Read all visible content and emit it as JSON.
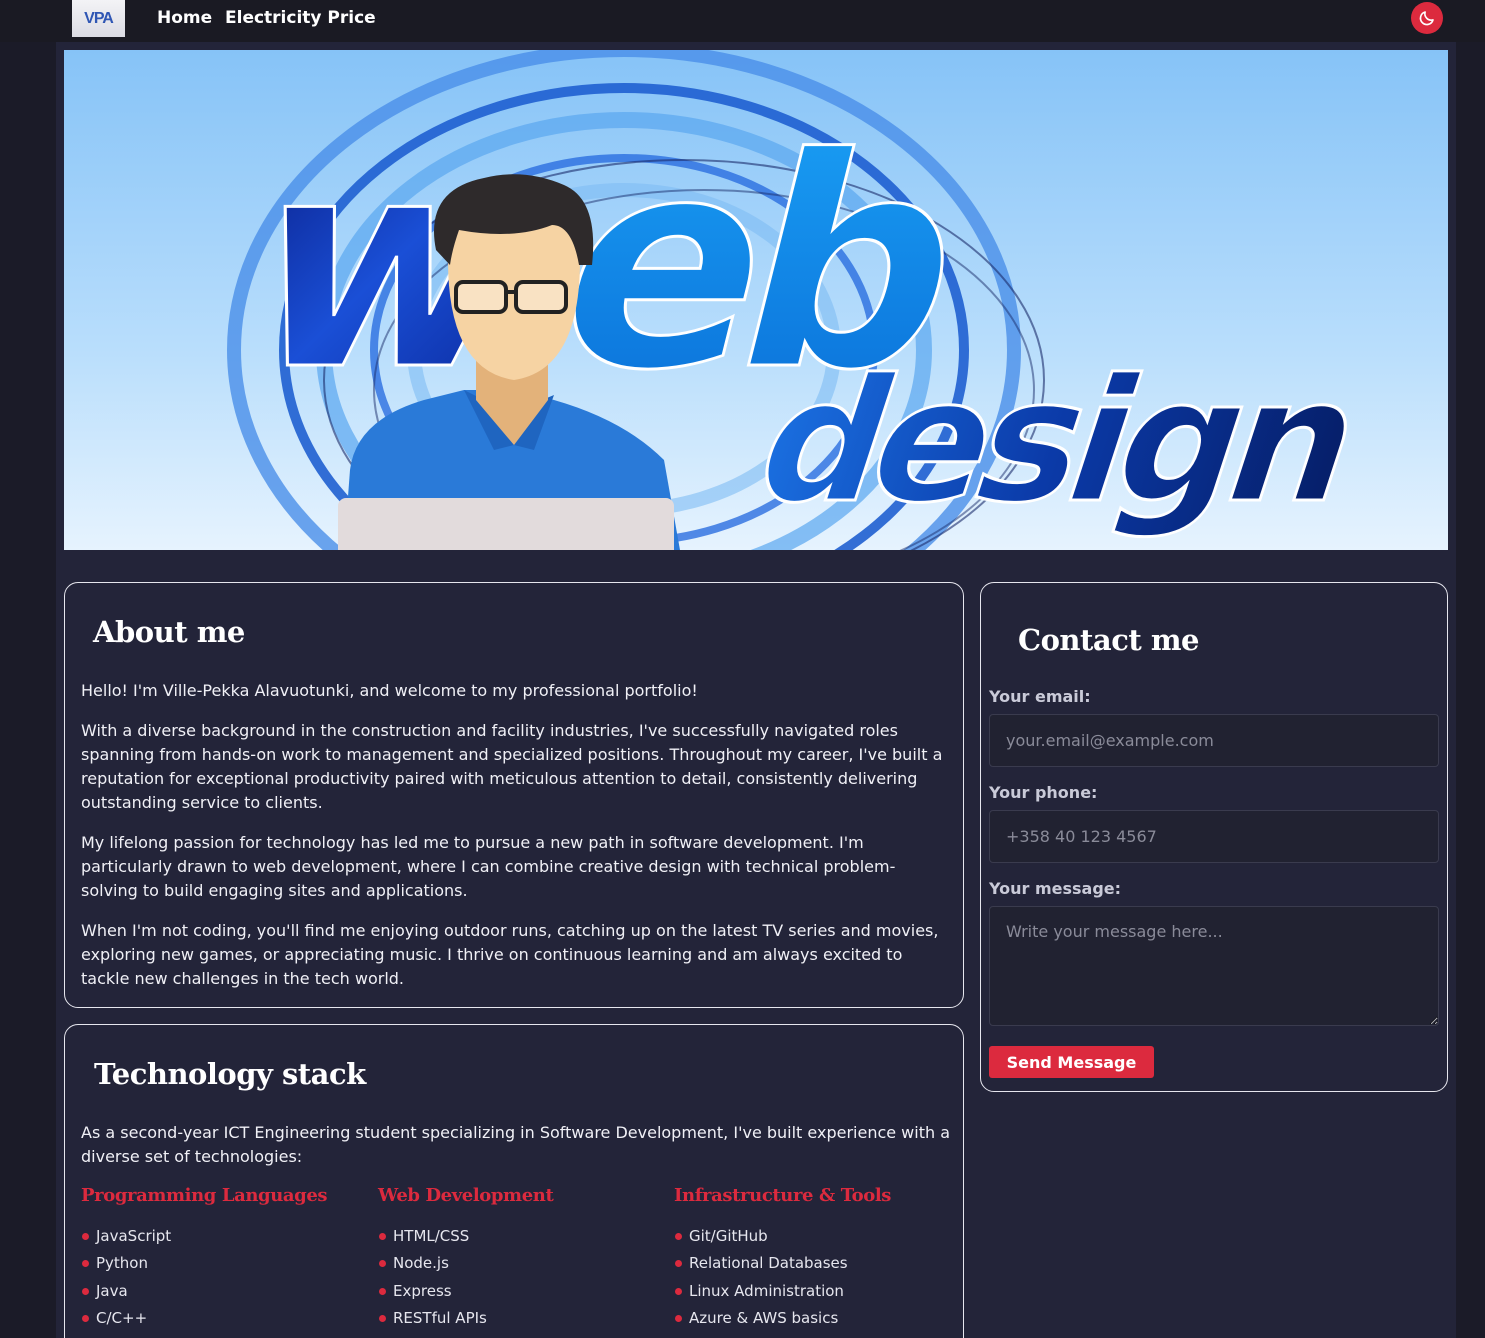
{
  "nav": {
    "logo_text": "VPA",
    "home_label": "Home",
    "electricity_label": "Electricity Price",
    "theme_icon": "moon-icon",
    "accent_color": "#dc2a3e"
  },
  "hero": {
    "title_word_1": "web",
    "title_word_2": "design"
  },
  "about": {
    "title": "About me",
    "paragraphs": [
      "Hello! I'm Ville-Pekka Alavuotunki, and welcome to my professional portfolio!",
      "With a diverse background in the construction and facility industries, I've successfully navigated roles spanning from hands-on work to management and specialized positions. Throughout my career, I've built a reputation for exceptional productivity paired with meticulous attention to detail, consistently delivering outstanding service to clients.",
      "My lifelong passion for technology has led me to pursue a new path in software development. I'm particularly drawn to web development, where I can combine creative design with technical problem-solving to build engaging sites and applications.",
      "When I'm not coding, you'll find me enjoying outdoor runs, catching up on the latest TV series and movies, exploring new games, or appreciating music. I thrive on continuous learning and am always excited to tackle new challenges in the tech world."
    ]
  },
  "tech": {
    "title": "Technology stack",
    "intro": "As a second-year ICT Engineering student specializing in Software Development, I've built experience with a diverse set of technologies:",
    "columns": [
      {
        "title": "Programming Languages",
        "items": [
          "JavaScript",
          "Python",
          "Java",
          "C/C++"
        ]
      },
      {
        "title": "Web Development",
        "items": [
          "HTML/CSS",
          "Node.js",
          "Express",
          "RESTful APIs"
        ]
      },
      {
        "title": "Infrastructure & Tools",
        "items": [
          "Git/GitHub",
          "Relational Databases",
          "Linux Administration",
          "Azure & AWS basics"
        ]
      }
    ]
  },
  "contact": {
    "title": "Contact me",
    "email_label": "Your email:",
    "email_placeholder": "your.email@example.com",
    "phone_label": "Your phone:",
    "phone_placeholder": "+358 40 123 4567",
    "message_label": "Your message:",
    "message_placeholder": "Write your message here...",
    "send_label": "Send Message"
  }
}
